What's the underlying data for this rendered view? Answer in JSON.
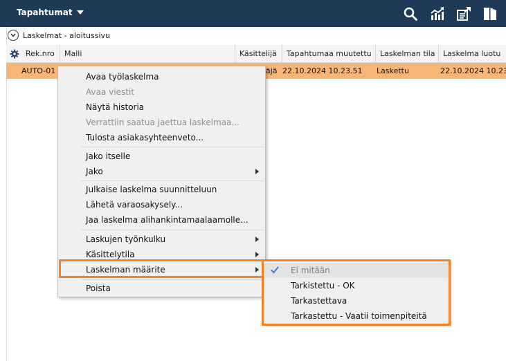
{
  "topbar": {
    "menu_label": "Tapahtumat",
    "icons": [
      "search-icon",
      "chart-icon",
      "export-icon",
      "book-icon"
    ],
    "background": "#1f3a56"
  },
  "breadcrumb": {
    "label": "Laskelmat - aloitussivu"
  },
  "table": {
    "columns": [
      "Rek.nro",
      "Malli",
      "Käsittelijä",
      "Tapahtumaa muutettu",
      "Laskelman tila",
      "Laskelma luotu"
    ],
    "rows": [
      {
        "rek_nro": "AUTO-01",
        "kasittelija": "äjä",
        "muutettu": "22.10.2024 10.23.51",
        "tila": "Laskettu",
        "luotu": "22.10.2024 10.23."
      }
    ],
    "selected_row_color": "#f7b677"
  },
  "context_menu": {
    "items": [
      {
        "label": "Avaa työlaskelma",
        "disabled": false
      },
      {
        "label": "Avaa viestit",
        "disabled": true
      },
      {
        "label": "Näytä historia",
        "disabled": false
      },
      {
        "label": "Verrattiin saatua jaettua laskelmaa...",
        "disabled": true
      },
      {
        "label": "Tulosta asiakasyhteenveto...",
        "disabled": false
      },
      {
        "label": "Jako itselle",
        "disabled": false
      },
      {
        "label": "Jako",
        "submenu": true
      },
      {
        "label": "Julkaise laskelma suunnitteluun",
        "disabled": false
      },
      {
        "label": "Lähetä varaosakysely...",
        "disabled": false
      },
      {
        "label": "Jaa laskelma alihankintamaalaamolle...",
        "disabled": false
      },
      {
        "label": "Laskujen työnkulku",
        "submenu": true
      },
      {
        "label": "Käsittelytila",
        "submenu": true
      },
      {
        "label": "Laskelman määrite",
        "submenu": true,
        "highlighted": true
      },
      {
        "label": "Poista",
        "disabled": false
      }
    ]
  },
  "submenu": {
    "items": [
      {
        "label": "Ei mitään",
        "checked": true
      },
      {
        "label": "Tarkistettu - OK"
      },
      {
        "label": "Tarkastettava"
      },
      {
        "label": "Tarkastettu - Vaatii toimenpiteitä"
      }
    ]
  },
  "highlight_color": "#f0832a"
}
